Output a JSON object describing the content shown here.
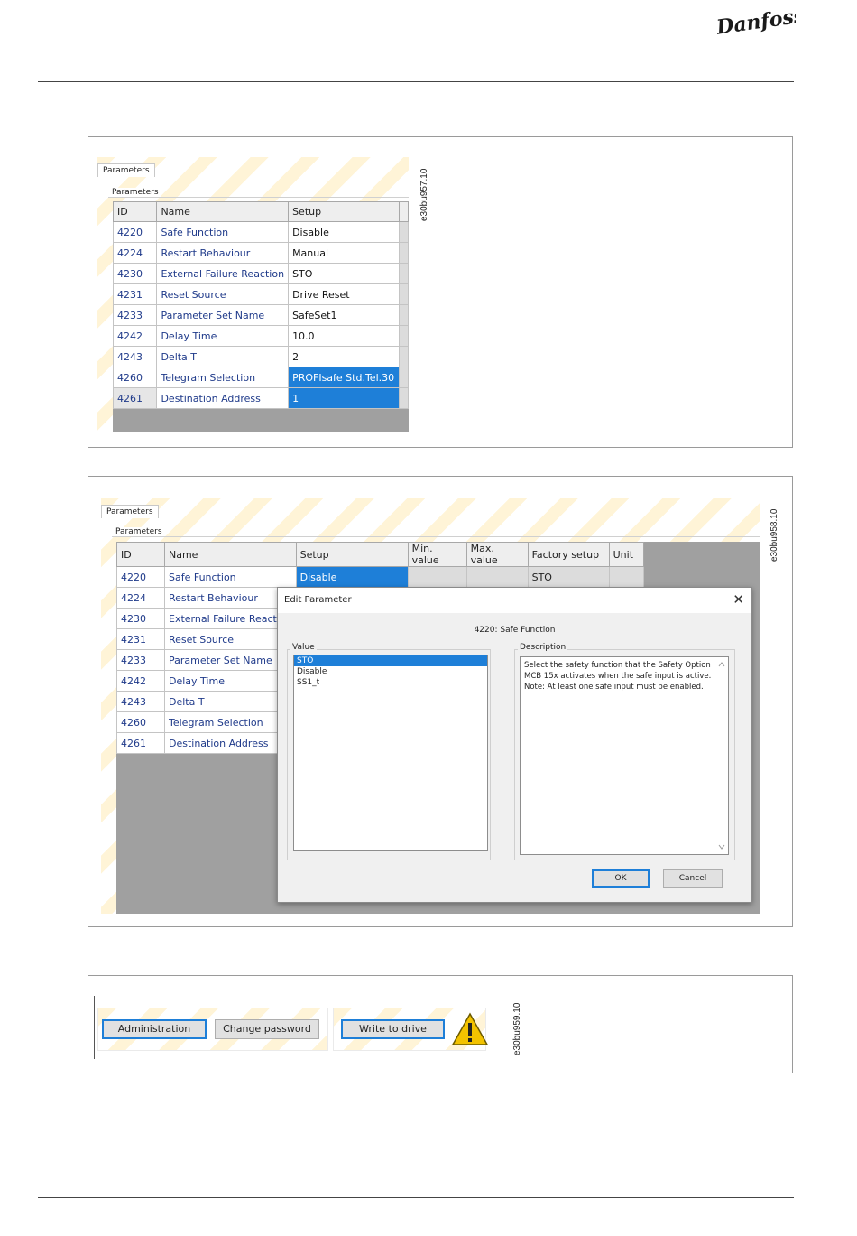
{
  "brand": "Danfoss",
  "figure1": {
    "ref": "e30bu957.10",
    "tab": "Parameters",
    "group": "Parameters",
    "columns": [
      "ID",
      "Name",
      "Setup"
    ],
    "rows": [
      {
        "id": "4220",
        "name": "Safe Function",
        "setup": "Disable"
      },
      {
        "id": "4224",
        "name": "Restart Behaviour",
        "setup": "Manual"
      },
      {
        "id": "4230",
        "name": "External Failure Reaction",
        "setup": "STO"
      },
      {
        "id": "4231",
        "name": "Reset Source",
        "setup": "Drive Reset"
      },
      {
        "id": "4233",
        "name": "Parameter Set Name",
        "setup": "SafeSet1"
      },
      {
        "id": "4242",
        "name": "Delay Time",
        "setup": "10.0"
      },
      {
        "id": "4243",
        "name": "Delta T",
        "setup": "2"
      },
      {
        "id": "4260",
        "name": "Telegram Selection",
        "setup": "PROFIsafe Std.Tel.30"
      },
      {
        "id": "4261",
        "name": "Destination Address",
        "setup": "1"
      }
    ]
  },
  "figure2": {
    "ref": "e30bu958.10",
    "tab": "Parameters",
    "group": "Parameters",
    "columns": [
      "ID",
      "Name",
      "Setup",
      "Min. value",
      "Max. value",
      "Factory setup",
      "Unit"
    ],
    "first_row": {
      "id": "4220",
      "name": "Safe Function",
      "setup": "Disable",
      "factory": "STO"
    },
    "rows": [
      {
        "id": "4224",
        "name": "Restart Behaviour"
      },
      {
        "id": "4230",
        "name": "External Failure Reaction"
      },
      {
        "id": "4231",
        "name": "Reset Source"
      },
      {
        "id": "4233",
        "name": "Parameter Set Name"
      },
      {
        "id": "4242",
        "name": "Delay Time"
      },
      {
        "id": "4243",
        "name": "Delta T"
      },
      {
        "id": "4260",
        "name": "Telegram Selection"
      },
      {
        "id": "4261",
        "name": "Destination Address"
      }
    ],
    "dialog": {
      "title": "Edit Parameter",
      "subtitle": "4220: Safe Function",
      "value_label": "Value",
      "values": [
        "STO",
        "Disable",
        "SS1_t"
      ],
      "selected_value": "STO",
      "description_label": "Description",
      "description": "Select the safety function that the Safety Option MCB 15x activates when the safe input is active. Note: At least one safe input must be enabled.",
      "ok": "OK",
      "cancel": "Cancel"
    }
  },
  "figure3": {
    "ref": "e30bu959.10",
    "administration": "Administration",
    "change_password": "Change password",
    "write_to_drive": "Write to drive"
  },
  "colors": {
    "selection": "#1e7fd8",
    "link_text": "#1f3a8a",
    "brand_text": "#1a1a1a",
    "warning": "#f2c200"
  }
}
